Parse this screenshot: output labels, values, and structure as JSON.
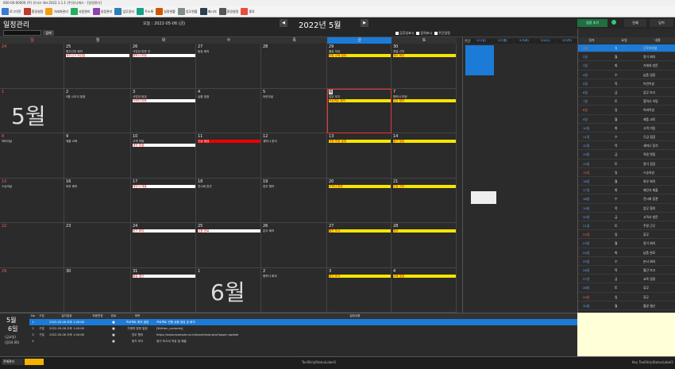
{
  "window": {
    "title": "000-00-00000 (주) 유닉스 Ver.2022.1.1.1 (주)유니에스 - [일정관리]"
  },
  "toolbar": [
    {
      "label": "로그아웃",
      "color": "#3a7bd5"
    },
    {
      "label": "환경설정",
      "color": "#c0392b"
    },
    {
      "label": "거래처관리",
      "color": "#f39c12"
    },
    {
      "label": "사원관리",
      "color": "#27ae60"
    },
    {
      "label": "일정관리",
      "color": "#8e44ad"
    },
    {
      "label": "업무일지",
      "color": "#2980b9"
    },
    {
      "label": "주소록",
      "color": "#16a085"
    },
    {
      "label": "일정현황",
      "color": "#d35400"
    },
    {
      "label": "업무현황",
      "color": "#7f8c8d"
    },
    {
      "label": "메시지",
      "color": "#2c3e50"
    },
    {
      "label": "환경설정",
      "color": "#555555"
    },
    {
      "label": "종료",
      "color": "#e74c3c"
    }
  ],
  "header": {
    "title": "일정관리",
    "today": "오늘 : 2022-05-06 (금)",
    "month": "2022년 5월",
    "prev": "◀",
    "next": "▶",
    "btn_add": "일정 추가",
    "btn_print": "인쇄",
    "btn_close": "닫기",
    "right_title": "5월",
    "right_sub": "매월 일정(월 일정)"
  },
  "subheader": {
    "search_value": "",
    "search_btn": "검색",
    "checks": [
      "공휴일표시",
      "음력표시",
      "주간일정"
    ]
  },
  "weekdays": [
    "일",
    "월",
    "화",
    "수",
    "목",
    "금",
    "토"
  ],
  "calendar": {
    "rows": [
      [
        {
          "d": "24",
          "ev": []
        },
        {
          "d": "25",
          "ev": [
            {
              "t": "원주간부 회의",
              "c": "t"
            },
            {
              "t": "세무신고 마감일",
              "c": "w"
            }
          ]
        },
        {
          "d": "26",
          "ev": [
            {
              "t": "사업장 방문 건",
              "c": "t"
            },
            {
              "t": "협력사 미팅",
              "c": "w"
            }
          ]
        },
        {
          "d": "27",
          "ev": [
            {
              "t": "팀장 회의",
              "c": "t"
            }
          ]
        },
        {
          "d": "28",
          "ev": []
        },
        {
          "d": "29",
          "ev": [
            {
              "t": "월말 마감",
              "c": "t"
            },
            {
              "t": "직원 교육 일정",
              "c": "y"
            }
          ]
        },
        {
          "d": "30",
          "ev": [
            {
              "t": "휴일 근무",
              "c": "t"
            },
            {
              "t": "재고 확인",
              "c": "y"
            }
          ]
        }
      ],
      [
        {
          "d": "1",
          "ev": []
        },
        {
          "d": "2",
          "ev": [
            {
              "t": "5월 시무식 일정",
              "c": "t"
            }
          ]
        },
        {
          "d": "3",
          "ev": [
            {
              "t": "사업장 점검",
              "c": "t"
            },
            {
              "t": "거래처 방문",
              "c": "w"
            }
          ]
        },
        {
          "d": "4",
          "ev": [
            {
              "t": "납품 일정",
              "c": "t"
            }
          ]
        },
        {
          "d": "5",
          "ev": [
            {
              "t": "어린이날",
              "c": "t"
            }
          ]
        },
        {
          "d": "6",
          "ev": [
            {
              "t": "업무 보고",
              "c": "t"
            },
            {
              "t": "프로젝트 회의",
              "c": "y"
            }
          ]
        },
        {
          "d": "7",
          "ev": [
            {
              "t": "협력사 미팅",
              "c": "t"
            },
            {
              "t": "업무 협의",
              "c": "y"
            }
          ]
        }
      ],
      [
        {
          "d": "8",
          "ev": [
            {
              "t": "어버이날",
              "c": "t"
            }
          ]
        },
        {
          "d": "9",
          "ev": [
            {
              "t": "제품 교육",
              "c": "t"
            }
          ]
        },
        {
          "d": "10",
          "ev": [
            {
              "t": "고객 미팅",
              "c": "t"
            },
            {
              "t": "계약 체결",
              "c": "w"
            }
          ]
        },
        {
          "d": "11",
          "ev": [
            {
              "t": "긴급 점검",
              "c": "r"
            }
          ]
        },
        {
          "d": "12",
          "ev": [
            {
              "t": "세미나 참석",
              "c": "t"
            }
          ]
        },
        {
          "d": "13",
          "ev": [
            {
              "t": "직원 면접 일정",
              "c": "y"
            }
          ]
        },
        {
          "d": "14",
          "ev": [
            {
              "t": "정기 점검",
              "c": "y"
            }
          ]
        }
      ],
      [
        {
          "d": "15",
          "ev": [
            {
              "t": "스승의날",
              "c": "t"
            }
          ]
        },
        {
          "d": "16",
          "ev": [
            {
              "t": "외부 회의",
              "c": "t"
            }
          ]
        },
        {
          "d": "17",
          "ev": [
            {
              "t": "제안서 제출",
              "c": "w"
            }
          ]
        },
        {
          "d": "18",
          "ev": [
            {
              "t": "전시회 참관",
              "c": "t"
            }
          ]
        },
        {
          "d": "19",
          "ev": [
            {
              "t": "업무 협의",
              "c": "t"
            }
          ]
        },
        {
          "d": "20",
          "ev": [
            {
              "t": "고객사 방문",
              "c": "y"
            }
          ]
        },
        {
          "d": "21",
          "ev": [
            {
              "t": "주말 근무",
              "c": "y"
            }
          ]
        }
      ],
      [
        {
          "d": "22",
          "ev": []
        },
        {
          "d": "23",
          "ev": []
        },
        {
          "d": "24",
          "ev": [
            {
              "t": "정기 회의",
              "c": "w"
            }
          ]
        },
        {
          "d": "25",
          "ev": [
            {
              "t": "납품 완료",
              "c": "w"
            }
          ]
        },
        {
          "d": "26",
          "ev": [
            {
              "t": "본사 회의",
              "c": "t"
            }
          ]
        },
        {
          "d": "27",
          "ev": [
            {
              "t": "월간 보고",
              "c": "y"
            }
          ]
        },
        {
          "d": "28",
          "ev": [
            {
              "t": "휴무",
              "c": "y"
            }
          ]
        }
      ],
      [
        {
          "d": "29",
          "ev": []
        },
        {
          "d": "30",
          "ev": []
        },
        {
          "d": "31",
          "ev": [
            {
              "t": "월말 결산",
              "c": "w"
            }
          ]
        },
        {
          "d": "1",
          "ev": []
        },
        {
          "d": "2",
          "ev": [
            {
              "t": "협력사 회의",
              "c": "t"
            }
          ]
        },
        {
          "d": "3",
          "ev": [
            {
              "t": "정기 보고",
              "c": "y"
            }
          ]
        },
        {
          "d": "4",
          "ev": [
            {
              "t": "교육 일정",
              "c": "y"
            }
          ]
        }
      ]
    ],
    "month5": "5월",
    "month6": "6월"
  },
  "week": {
    "label": "주간 일정",
    "cols": [
      "5/1(일)",
      "5/2(월)",
      "5/3(화)",
      "5/4(수)",
      "5/5(목)"
    ]
  },
  "right": {
    "cols": [
      "일자",
      "요일",
      "내용"
    ],
    "items": [
      [
        "1일",
        "일",
        "근로자의날"
      ],
      [
        "2일",
        "월",
        "정기 회의"
      ],
      [
        "3일",
        "화",
        "거래처 방문"
      ],
      [
        "4일",
        "수",
        "납품 일정"
      ],
      [
        "5일",
        "목",
        "어린이날"
      ],
      [
        "6일",
        "금",
        "업무 보고"
      ],
      [
        "7일",
        "토",
        "협력사 미팅"
      ],
      [
        "8일",
        "일",
        "어버이날"
      ],
      [
        "9일",
        "월",
        "제품 교육"
      ],
      [
        "10일",
        "화",
        "고객 미팅"
      ],
      [
        "11일",
        "수",
        "긴급 점검"
      ],
      [
        "12일",
        "목",
        "세미나 참석"
      ],
      [
        "13일",
        "금",
        "직원 면접"
      ],
      [
        "14일",
        "토",
        "정기 점검"
      ],
      [
        "15일",
        "일",
        "스승의날"
      ],
      [
        "16일",
        "월",
        "외부 회의"
      ],
      [
        "17일",
        "화",
        "제안서 제출"
      ],
      [
        "18일",
        "수",
        "전시회 참관"
      ],
      [
        "19일",
        "목",
        "업무 협의"
      ],
      [
        "20일",
        "금",
        "고객사 방문"
      ],
      [
        "21일",
        "토",
        "주말 근무"
      ],
      [
        "22일",
        "일",
        "휴무"
      ],
      [
        "23일",
        "월",
        "정기 회의"
      ],
      [
        "24일",
        "화",
        "납품 완료"
      ],
      [
        "25일",
        "수",
        "본사 회의"
      ],
      [
        "26일",
        "목",
        "월간 보고"
      ],
      [
        "27일",
        "금",
        "교육 일정"
      ],
      [
        "28일",
        "토",
        "휴무"
      ],
      [
        "29일",
        "일",
        "휴무"
      ],
      [
        "30일",
        "월",
        "월말 결산"
      ]
    ]
  },
  "bottom": {
    "date_month": "5월",
    "date_day": "6일",
    "date_weekday": "(금요일)",
    "date_lunar": "(음04.06)",
    "cols": [
      "No",
      "구분",
      "일자일정",
      "최종변경",
      "완료",
      "제목",
      "일정내용"
    ],
    "rows": [
      [
        "1",
        "",
        "2022-05-06 오후 1:40:08",
        "",
        "■",
        "프로젝트 회의 일정",
        "프로젝트 진행 상황 점검 및 회의"
      ],
      [
        "2",
        "구분",
        "2022-05-06 오후 1:40:08",
        "",
        "■",
        "거래처 방문 일정",
        "[Written_contents]"
      ],
      [
        "3",
        "구분",
        "2022-05-06 오후 1:40:08",
        "",
        "■",
        "업무 협의",
        "https://www.example.co.kr/board/read.php?page=update"
      ],
      [
        "4",
        "",
        "",
        "",
        "■",
        "정기 보고",
        "정기 보고서 작성 및 제출"
      ]
    ]
  },
  "status": {
    "left": "전체관리",
    "center": "ToolStripStatusLabel1",
    "right": "Key  ToolStripStatusLabel2"
  }
}
